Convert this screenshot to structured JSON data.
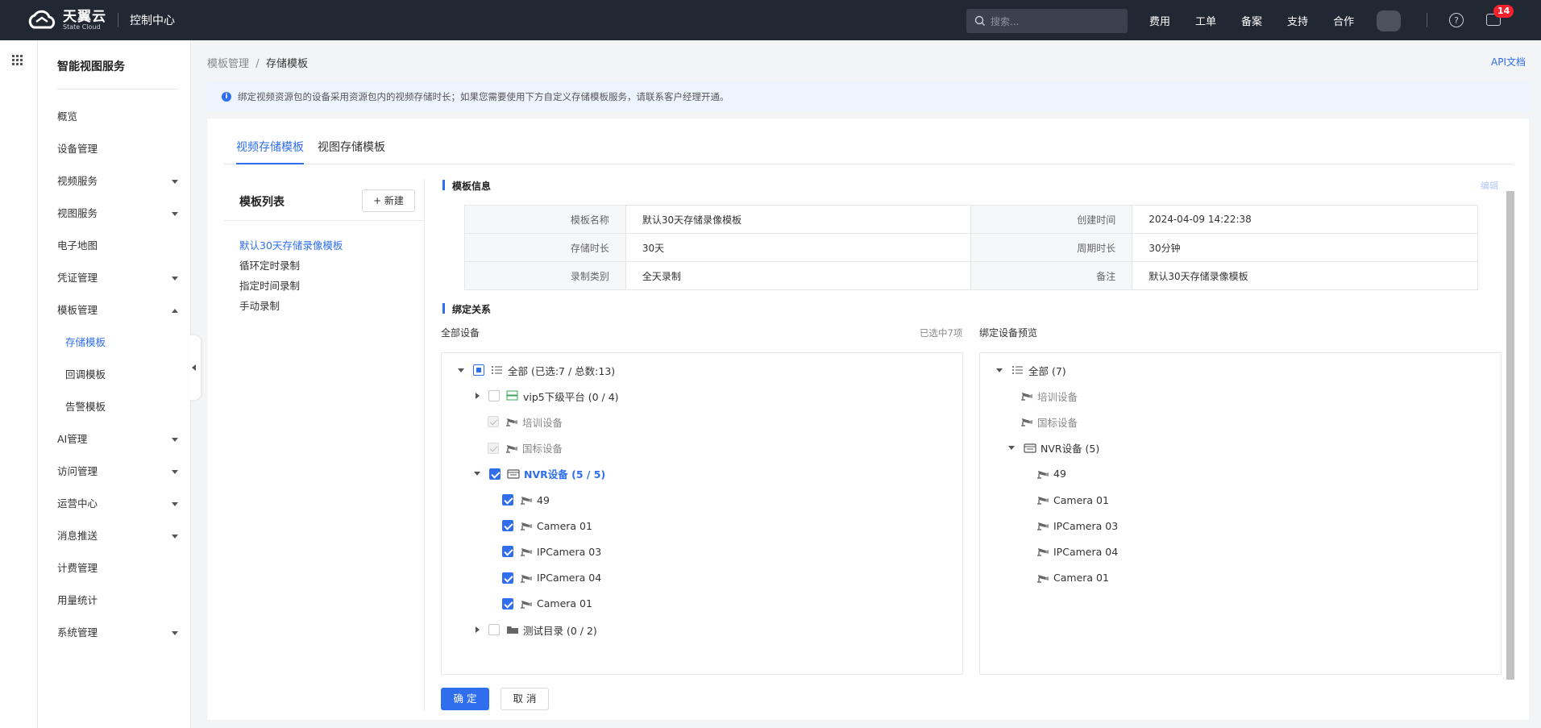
{
  "topbar": {
    "brand_cn": "天翼云",
    "brand_en": "State Cloud",
    "console": "控制中心",
    "search_placeholder": "搜索...",
    "nav": [
      "费用",
      "工单",
      "备案",
      "支持",
      "合作"
    ],
    "help_glyph": "?",
    "message_count": "14"
  },
  "sidebar": {
    "title": "智能视图服务",
    "items": [
      {
        "label": "概览",
        "caret": ""
      },
      {
        "label": "设备管理",
        "caret": ""
      },
      {
        "label": "视频服务",
        "caret": "down"
      },
      {
        "label": "视图服务",
        "caret": "down"
      },
      {
        "label": "电子地图",
        "caret": ""
      },
      {
        "label": "凭证管理",
        "caret": "down"
      },
      {
        "label": "模板管理",
        "caret": "up"
      },
      {
        "label": "存储模板",
        "sub": true,
        "active": true
      },
      {
        "label": "回调模板",
        "sub": true
      },
      {
        "label": "告警模板",
        "sub": true
      },
      {
        "label": "AI管理",
        "caret": "down"
      },
      {
        "label": "访问管理",
        "caret": "down"
      },
      {
        "label": "运营中心",
        "caret": "down"
      },
      {
        "label": "消息推送",
        "caret": "down"
      },
      {
        "label": "计费管理",
        "caret": ""
      },
      {
        "label": "用量统计",
        "caret": ""
      },
      {
        "label": "系统管理",
        "caret": "down"
      }
    ]
  },
  "breadcrumb": {
    "parent": "模板管理",
    "sep": "/",
    "current": "存储模板"
  },
  "api_doc": "API文档",
  "notice": "绑定视频资源包的设备采用资源包内的视频存储时长；如果您需要使用下方自定义存储模板服务，请联系客户经理开通。",
  "tabs": [
    "视频存储模板",
    "视图存储模板"
  ],
  "template_list": {
    "title": "模板列表",
    "new_button": "+ 新建",
    "items": [
      "默认30天存储录像模板",
      "循环定时录制",
      "指定时间录制",
      "手动录制"
    ]
  },
  "info": {
    "title": "模板信息",
    "edit": "编辑",
    "rows": [
      [
        "模板名称",
        "默认30天存储录像模板",
        "创建时间",
        "2024-04-09 14:22:38"
      ],
      [
        "存储时长",
        "30天",
        "周期时长",
        "30分钟"
      ],
      [
        "录制类别",
        "全天录制",
        "备注",
        "默认30天存储录像模板"
      ]
    ]
  },
  "binding": {
    "title": "绑定关系",
    "all_devices": "全部设备",
    "selected_count": "已选中7项",
    "preview": "绑定设备预览",
    "left_tree": [
      {
        "label": "全部 (已选:7 / 总数:13)"
      },
      {
        "label": "vip5下级平台 (0 / 4)"
      },
      {
        "label": "培训设备"
      },
      {
        "label": "国标设备"
      },
      {
        "label": "NVR设备 (5 / 5)"
      },
      {
        "label": "49"
      },
      {
        "label": "Camera 01"
      },
      {
        "label": "IPCamera 03"
      },
      {
        "label": "IPCamera 04"
      },
      {
        "label": "Camera 01"
      },
      {
        "label": "测试目录 (0 / 2)"
      }
    ],
    "right_tree": [
      {
        "label": "全部 (7)"
      },
      {
        "label": "培训设备"
      },
      {
        "label": "国标设备"
      },
      {
        "label": "NVR设备 (5)"
      },
      {
        "label": "49"
      },
      {
        "label": "Camera 01"
      },
      {
        "label": "IPCamera 03"
      },
      {
        "label": "IPCamera 04"
      },
      {
        "label": "Camera 01"
      }
    ]
  },
  "buttons": {
    "ok": "确 定",
    "cancel": "取 消"
  },
  "colors": {
    "accent": "#2f6fee",
    "topbar": "#222833",
    "badge": "#f5222d"
  }
}
